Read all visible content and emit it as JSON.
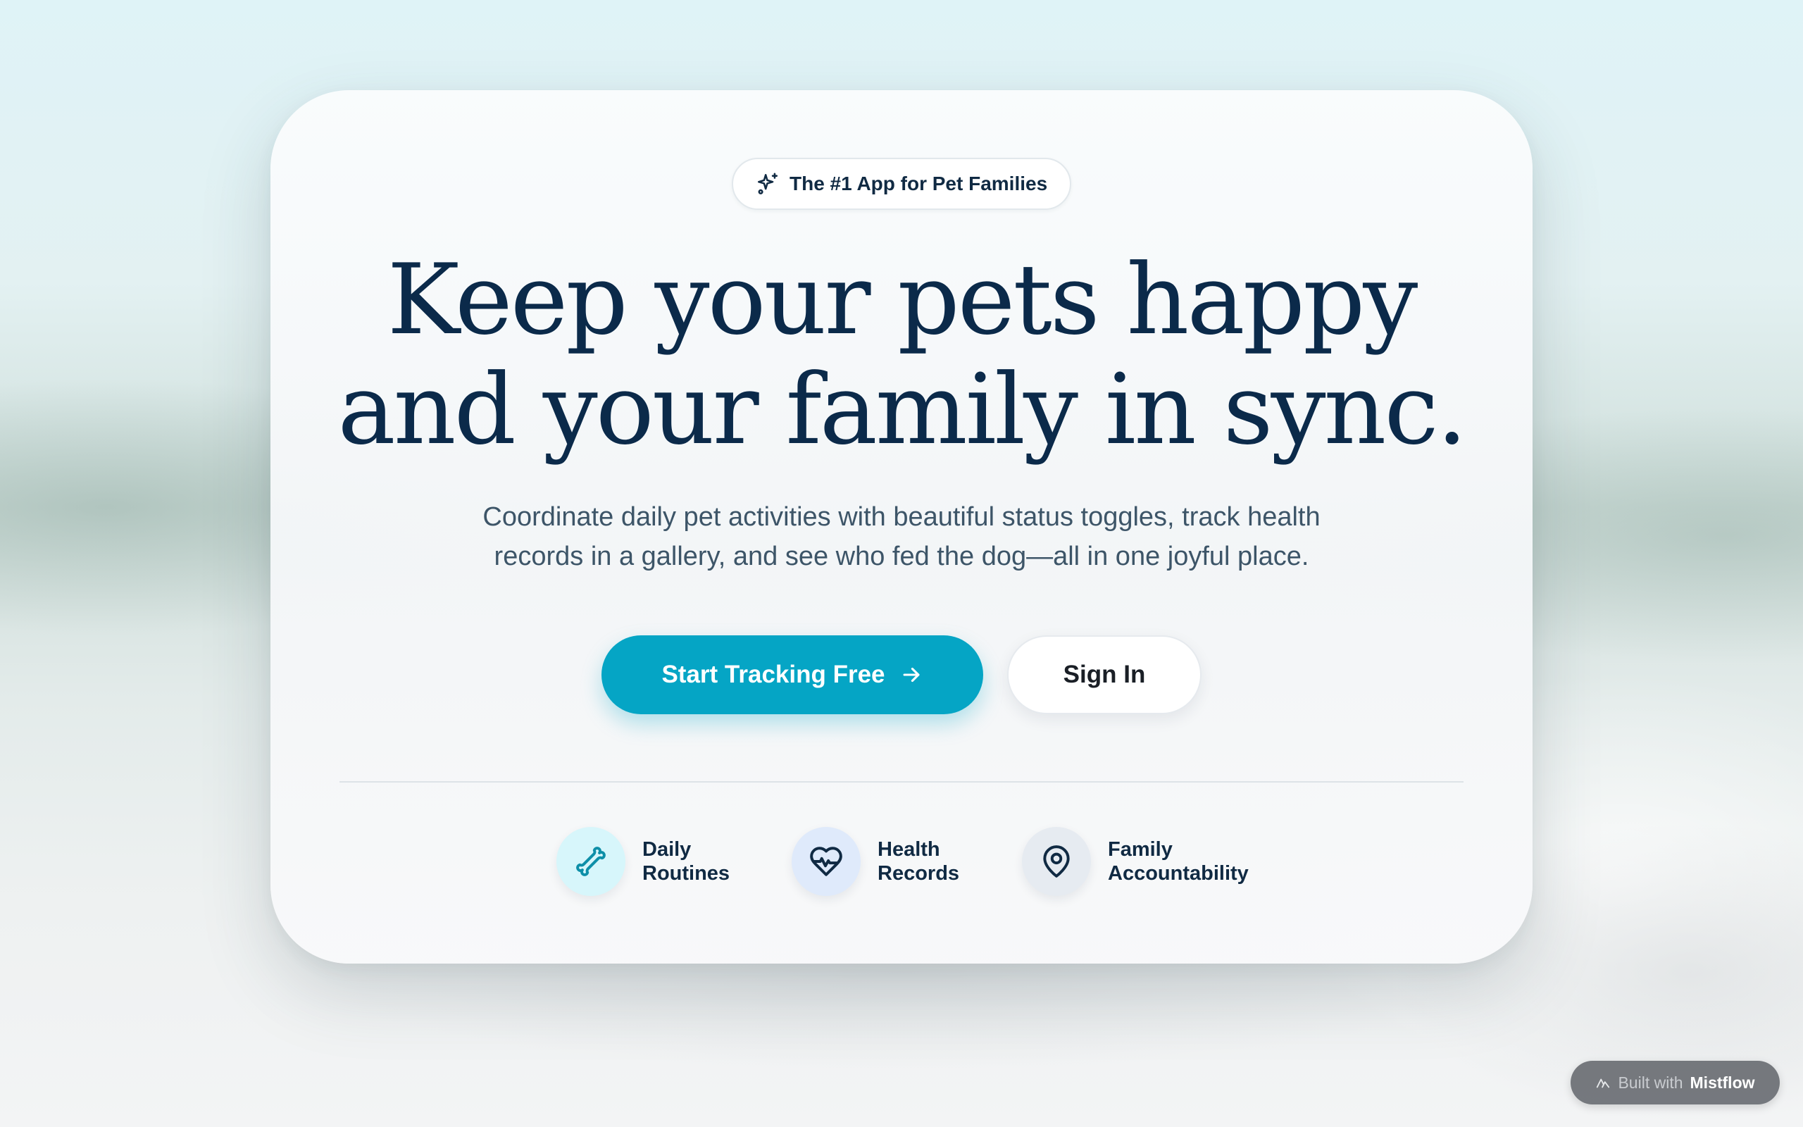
{
  "hero": {
    "badge": {
      "icon": "sparkles-icon",
      "text": "The #1 App for Pet Families"
    },
    "headline_lines": [
      "Keep your pets happy",
      "and your family in sync."
    ],
    "subtitle_lines": [
      "Coordinate daily pet activities with beautiful status toggles, track health",
      "records in a gallery, and see who fed the dog—all in one joyful place."
    ],
    "primary_cta": {
      "label": "Start Tracking Free",
      "icon": "arrow-right-icon"
    },
    "secondary_cta": {
      "label": "Sign In"
    }
  },
  "features": [
    {
      "icon": "bone-icon",
      "label": "Daily\nRoutines"
    },
    {
      "icon": "heart-pulse-icon",
      "label": "Health\nRecords"
    },
    {
      "icon": "map-pin-icon",
      "label": "Family\nAccountability"
    }
  ],
  "footer_badge": {
    "icon": "mistflow-logo-icon",
    "prefix": "Built with",
    "brand": "Mistflow"
  },
  "colors": {
    "primary": "#05a5c5",
    "headline": "#0b2a4a",
    "text": "#3d5568"
  }
}
